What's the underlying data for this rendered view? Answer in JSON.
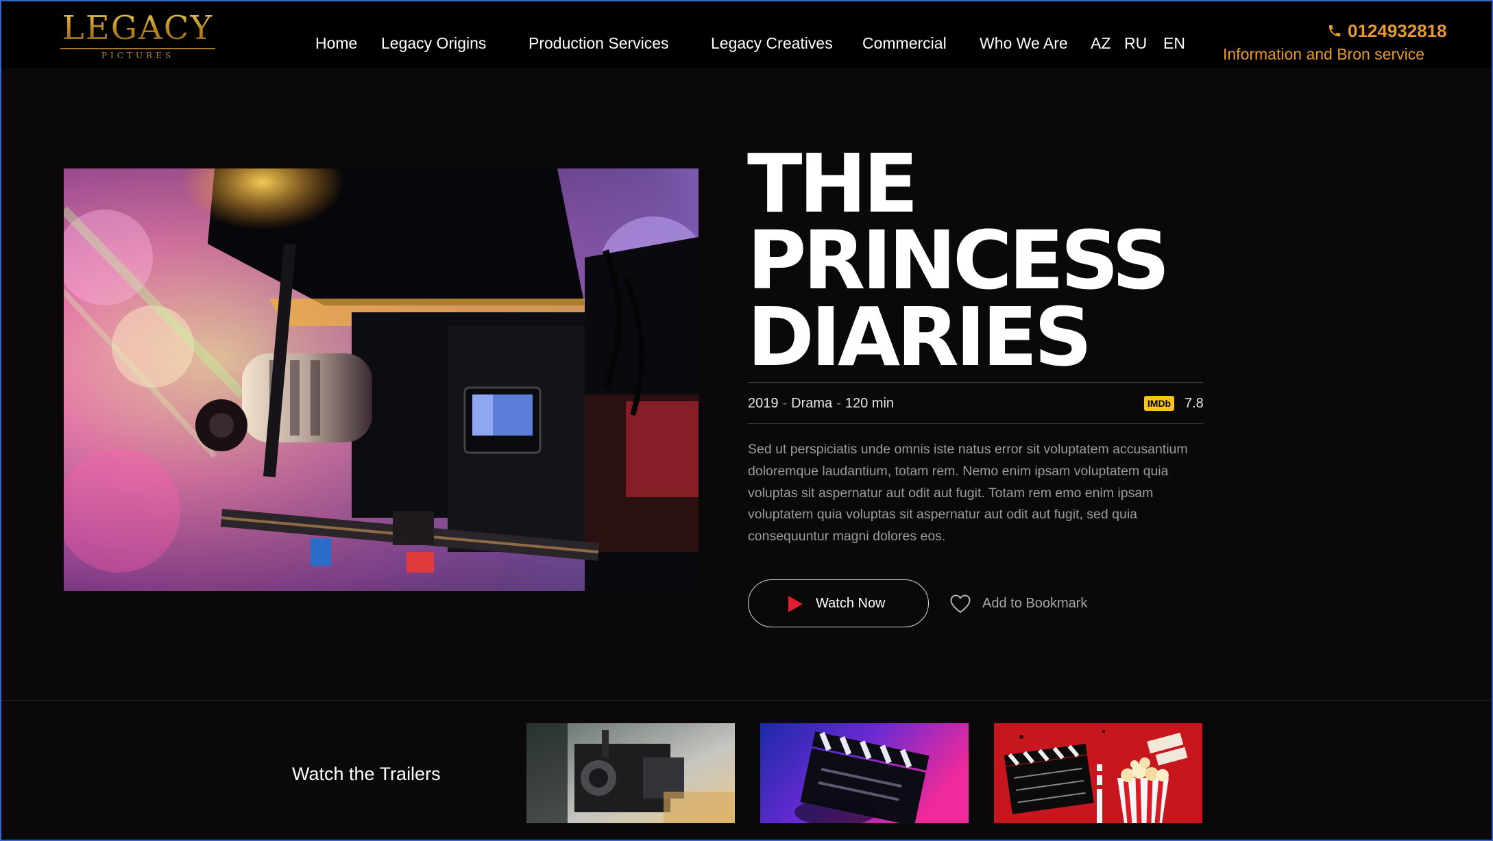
{
  "brand": {
    "logo_main": "LEGACY",
    "logo_sub": "PICTURES",
    "colors": {
      "gold": "#c89b2c",
      "accent": "#e89a2c",
      "play_red": "#e01f34",
      "imdb": "#f5c518"
    }
  },
  "nav": {
    "items": [
      {
        "label": "Home"
      },
      {
        "label": "Legacy Origins"
      },
      {
        "label": "Production  Services"
      },
      {
        "label": "Legacy Creatives"
      },
      {
        "label": "Commercial"
      },
      {
        "label": "Who We Are"
      },
      {
        "label": "AZ"
      },
      {
        "label": "RU"
      },
      {
        "label": "EN"
      }
    ]
  },
  "contact": {
    "icon": "phone-icon",
    "phone": "0124932818",
    "service": "Information and Bron service"
  },
  "hero": {
    "image_icon": "film-camera-photo",
    "title_lines": [
      "THE",
      "PRINCESS",
      "DIARIES"
    ],
    "year": "2019",
    "genre": "Drama",
    "duration": "120 min",
    "separator": "-",
    "imdb_label": "IMDb",
    "imdb_rating": "7.8",
    "description": "Sed ut perspiciatis unde omnis iste natus error sit voluptatem accusantium doloremque laudantium, totam rem. Nemo enim ipsam voluptatem quia voluptas sit aspernatur aut odit aut fugit. Totam rem emo enim ipsam voluptatem quia voluptas sit aspernatur aut odit aut fugit, sed quia consequuntur magni dolores eos.",
    "watch_label": "Watch Now",
    "bookmark_label": "Add to Bookmark"
  },
  "trailers": {
    "label": "Watch the Trailers",
    "thumbnails": [
      {
        "subject": "film-camera-rig"
      },
      {
        "subject": "clapperboard-neon"
      },
      {
        "subject": "clapperboard-popcorn"
      }
    ]
  }
}
